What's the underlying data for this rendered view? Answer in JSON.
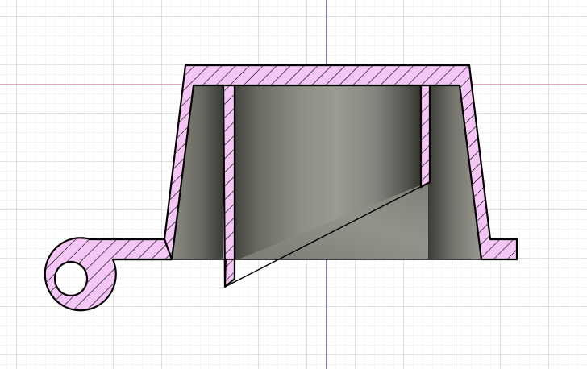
{
  "viewport": {
    "type": "cad-section-view",
    "background": "#ffffff",
    "grid_minor_color": "#e2e2e2",
    "grid_major_color": "#c6c6c6",
    "axis_horizontal_color": "#e4a8b8",
    "axis_vertical_color": "#7a7ad8"
  },
  "section": {
    "hatch_fill_color": "#f5c6f5",
    "hatch_line_color": "#000000",
    "outline_color": "#000000",
    "shaded_surface_light": "#9a9a90",
    "shaded_surface_dark": "#3e3e3a"
  }
}
